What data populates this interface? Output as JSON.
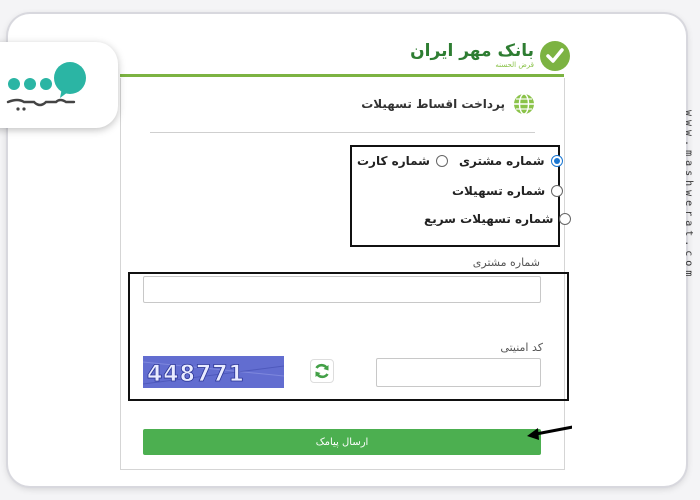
{
  "bank": {
    "name": "بانک مهر ایران",
    "subtitle": "قرض الحسنه"
  },
  "section": {
    "title": "پرداخت اقساط تسهیلات",
    "icon": "globe-icon"
  },
  "search_type": {
    "options": [
      {
        "label": "شماره مشتری",
        "checked": true
      },
      {
        "label": "شماره کارت",
        "checked": false
      },
      {
        "label": "شماره تسهیلات",
        "checked": false
      },
      {
        "label": "شماره تسهیلات سریع",
        "checked": false
      }
    ]
  },
  "customer_number": {
    "label": "شماره مشتری",
    "value": ""
  },
  "security_code": {
    "label": "کد امنیتی",
    "value": "",
    "captcha_text": "448771",
    "refresh_icon": "refresh-icon"
  },
  "submit": {
    "label": "ارسال پیامک"
  },
  "watermark": "www.mashwerat.com",
  "brand": {
    "logo": "mashwerat-logo"
  },
  "colors": {
    "brand_green": "#7cb342",
    "button_green": "#4caf50",
    "captcha_blue": "#5561c9",
    "radio_blue": "#1976d2",
    "brand_teal": "#2bb5a4"
  }
}
